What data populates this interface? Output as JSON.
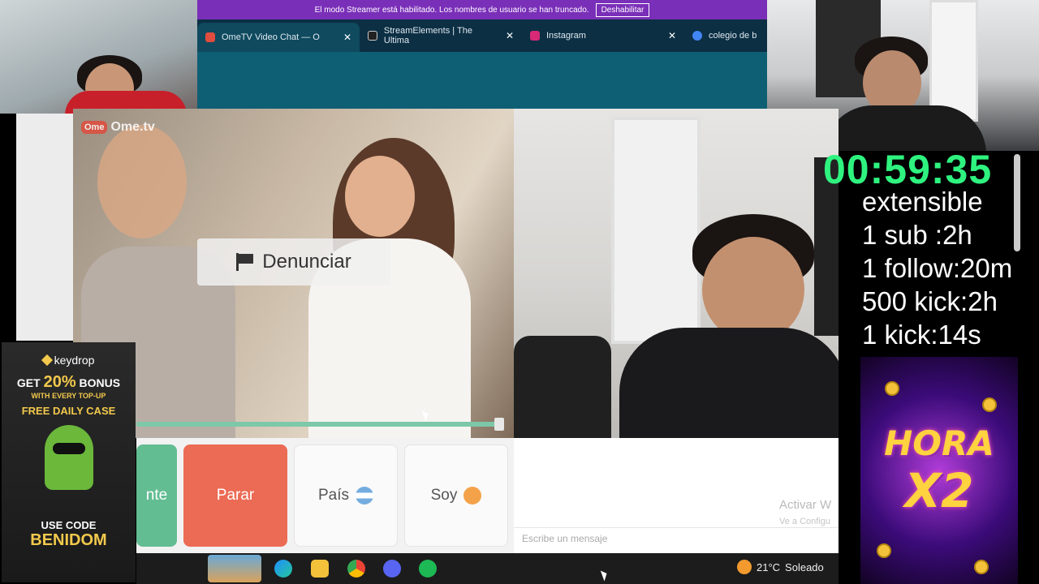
{
  "streamer_bar": {
    "message": "El modo Streamer está habilitado. Los nombres de usuario se han truncado.",
    "button": "Deshabilitar"
  },
  "tabs": [
    {
      "label": "OmeTV Video Chat — O",
      "favicon_color": "#e04c3d"
    },
    {
      "label": "StreamElements | The Ultima",
      "favicon_color": "#222222"
    },
    {
      "label": "Instagram",
      "favicon_color": "#d62976"
    },
    {
      "label": "colegio de b",
      "favicon_color": "#4285f4"
    }
  ],
  "video": {
    "logo_mark": "Ome",
    "logo_text": "Ome.tv",
    "report_label": "Denunciar"
  },
  "controls": {
    "next_label": "nte",
    "stop_label": "Parar",
    "country_label": "País",
    "me_label": "Soy"
  },
  "chat": {
    "placeholder": "Escribe un mensaje",
    "watermark_title": "Activar W",
    "watermark_sub": "Ve a Configu"
  },
  "taskbar": {
    "weather_temp": "21°C",
    "weather_desc": "Soleado",
    "icons": [
      "edge-icon",
      "file-explorer-icon",
      "chrome-icon",
      "discord-icon",
      "spotify-icon"
    ]
  },
  "overlay": {
    "timer": "00:59:35",
    "goals": [
      "extensible",
      "1 sub :2h",
      "1 follow:20m",
      "500 kick:2h",
      "1 kick:14s"
    ]
  },
  "promo_right": {
    "line1": "HORA",
    "line2": "X2"
  },
  "promo_left": {
    "brand": "keydrop",
    "get": "GET",
    "percent": "20%",
    "bonus": "BONUS",
    "with_prefix": "WITH",
    "with_every": "EVERY",
    "with_suffix": "TOP-UP",
    "free_case": "FREE DAILY CASE",
    "use_code": "USE CODE",
    "code": "BENIDOM"
  }
}
